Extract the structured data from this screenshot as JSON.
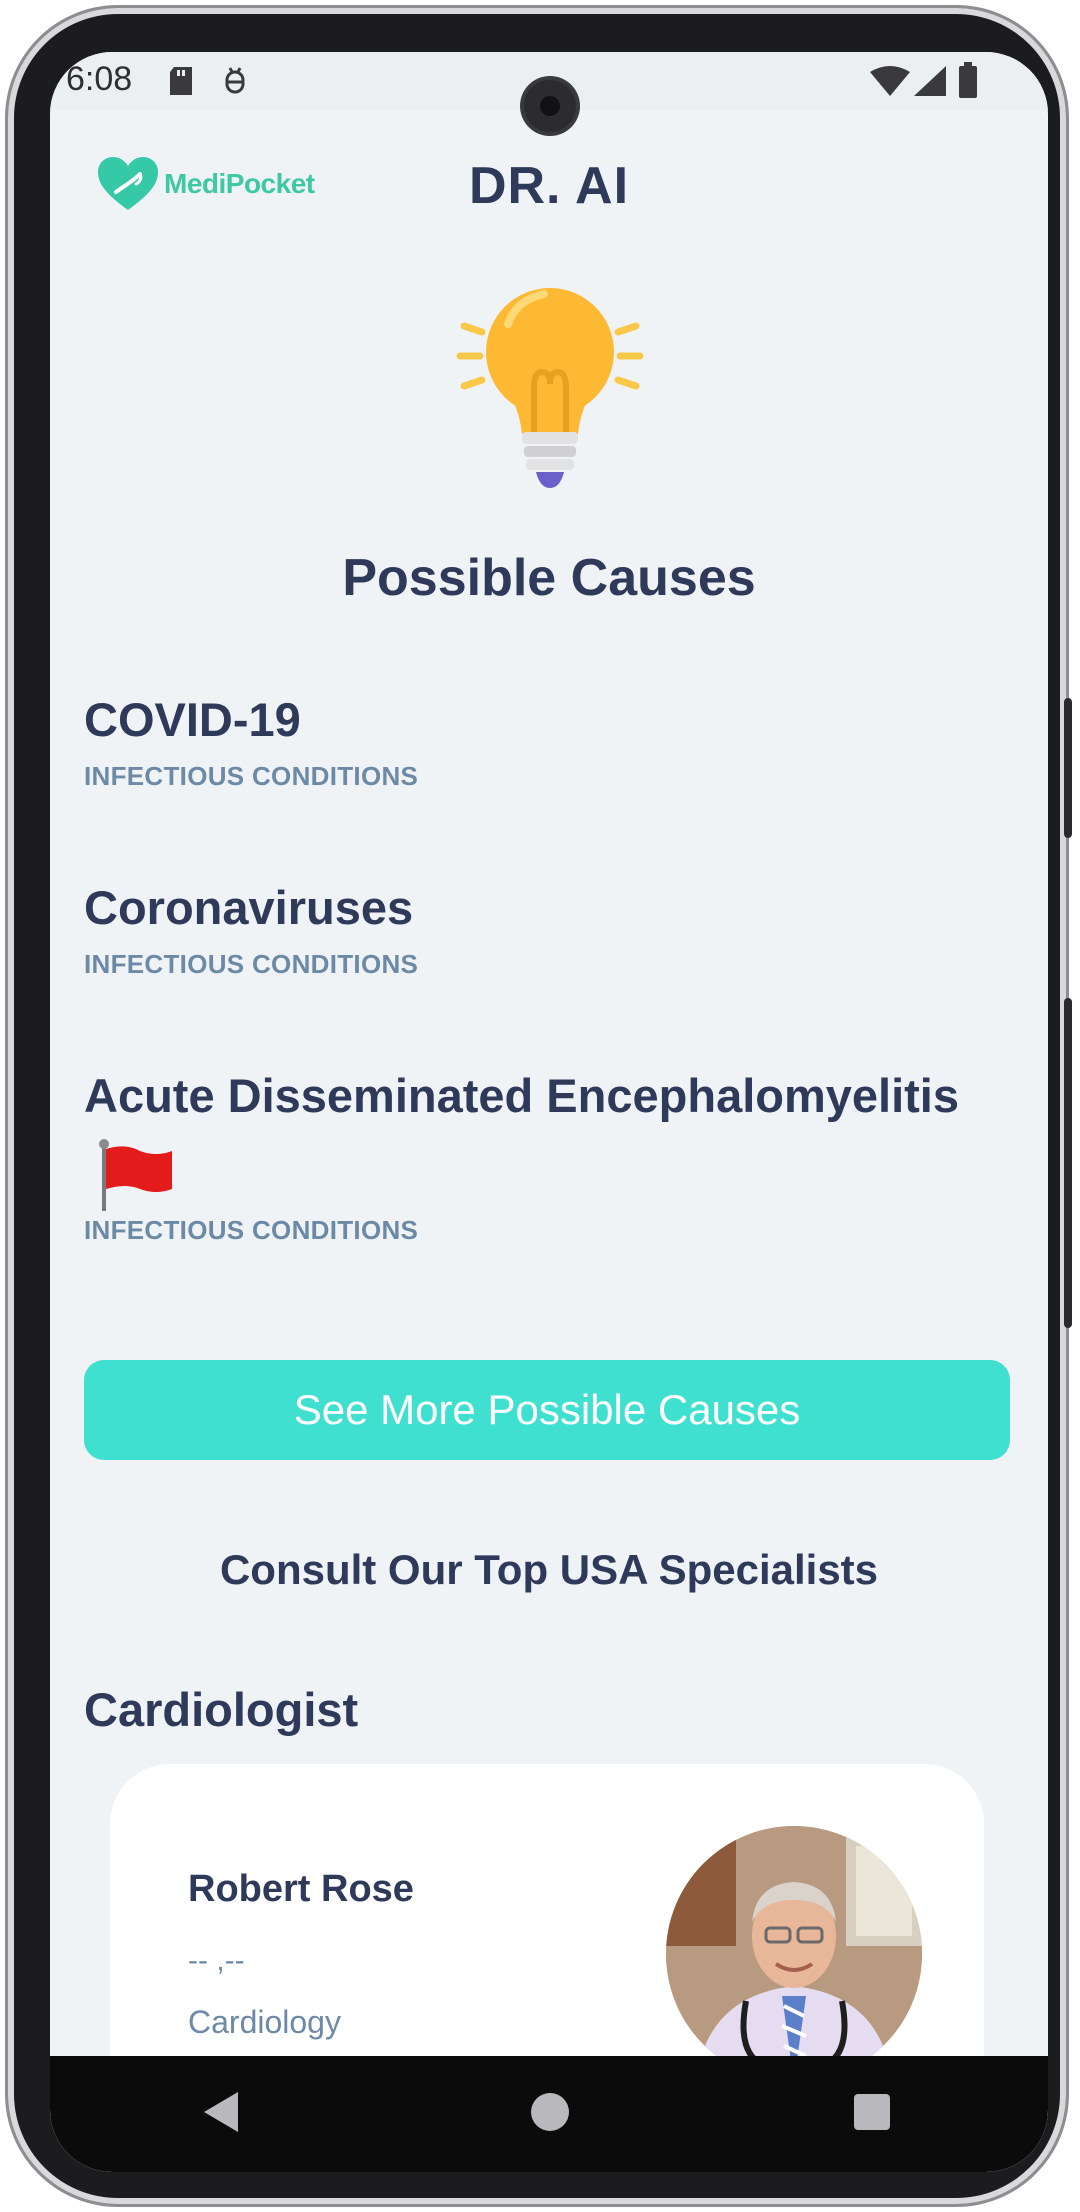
{
  "status_bar": {
    "time": "6:08"
  },
  "header": {
    "logo_text": "MediPocket",
    "title": "DR. AI"
  },
  "section_title": "Possible Causes",
  "causes": [
    {
      "name": "COVID-19",
      "category": "INFECTIOUS CONDITIONS",
      "flagged": false
    },
    {
      "name": "Coronaviruses",
      "category": "INFECTIOUS CONDITIONS",
      "flagged": false
    },
    {
      "name": "Acute Disseminated Encephalomyelitis",
      "category": "INFECTIOUS CONDITIONS",
      "flagged": true
    }
  ],
  "see_more_label": "See More Possible Causes",
  "consult_title": "Consult Our Top USA Specialists",
  "specialty": "Cardiologist",
  "doctor": {
    "name": "Robert Rose",
    "rating": "-- ,--",
    "department": "Cardiology"
  },
  "colors": {
    "accent": "#3fe0d0",
    "brand": "#3ec9a0",
    "heading": "#2f3a5a",
    "muted": "#6c8aa5",
    "flag": "#e31b1b"
  },
  "icons": [
    "medipocket-logo",
    "lightbulb-icon",
    "red-flag-icon",
    "back-icon",
    "home-icon",
    "recents-icon"
  ]
}
